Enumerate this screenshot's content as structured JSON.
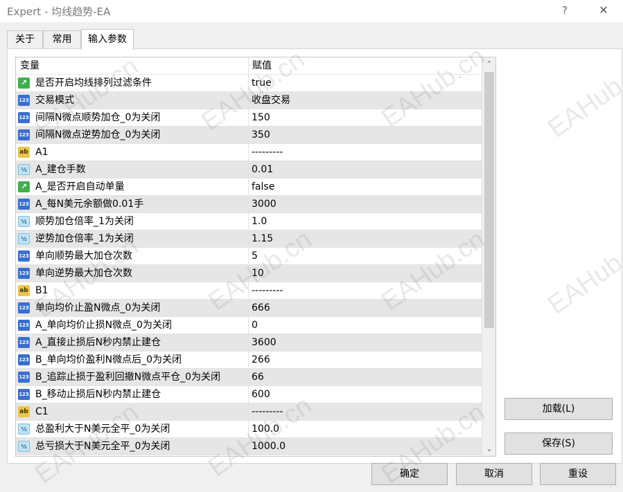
{
  "window": {
    "title": "Expert - 均线趋势-EA",
    "help_label": "?",
    "close_label": "✕"
  },
  "tabs": [
    {
      "label": "关于"
    },
    {
      "label": "常用"
    },
    {
      "label": "输入参数"
    }
  ],
  "grid": {
    "header": {
      "variable": "变量",
      "value": "赋值"
    },
    "rows": [
      {
        "type": "bool",
        "name": "是否开启均线排列过滤条件",
        "value": "true"
      },
      {
        "type": "int",
        "name": "交易模式",
        "value": "收盘交易"
      },
      {
        "type": "int",
        "name": "间隔N微点顺势加仓_0为关闭",
        "value": "150"
      },
      {
        "type": "int",
        "name": "间隔N微点逆势加仓_0为关闭",
        "value": "350"
      },
      {
        "type": "str",
        "name": "A1",
        "value": "---------"
      },
      {
        "type": "dbl",
        "name": "A_建仓手数",
        "value": "0.01"
      },
      {
        "type": "bool",
        "name": "A_是否开启自动单量",
        "value": "false"
      },
      {
        "type": "int",
        "name": "A_每N美元余额做0.01手",
        "value": "3000"
      },
      {
        "type": "dbl",
        "name": "顺势加仓倍率_1为关闭",
        "value": "1.0"
      },
      {
        "type": "dbl",
        "name": "逆势加仓倍率_1为关闭",
        "value": "1.15"
      },
      {
        "type": "int",
        "name": "单向顺势最大加仓次数",
        "value": "5"
      },
      {
        "type": "int",
        "name": "单向逆势最大加仓次数",
        "value": "10"
      },
      {
        "type": "str",
        "name": "B1",
        "value": "---------"
      },
      {
        "type": "int",
        "name": "单向均价止盈N微点_0为关闭",
        "value": "666"
      },
      {
        "type": "int",
        "name": "A_单向均价止损N微点_0为关闭",
        "value": "0"
      },
      {
        "type": "int",
        "name": "A_直接止损后N秒内禁止建仓",
        "value": "3600"
      },
      {
        "type": "int",
        "name": "B_单向均价盈利N微点后_0为关闭",
        "value": "266"
      },
      {
        "type": "int",
        "name": "B_追踪止损于盈利回撤N微点平仓_0为关闭",
        "value": "66"
      },
      {
        "type": "int",
        "name": "B_移动止损后N秒内禁止建仓",
        "value": "600"
      },
      {
        "type": "str",
        "name": "C1",
        "value": "---------"
      },
      {
        "type": "dbl",
        "name": "总盈利大于N美元全平_0为关闭",
        "value": "100.0"
      },
      {
        "type": "dbl",
        "name": "总亏损大于N美元全平_0为关闭",
        "value": "1000.0"
      }
    ],
    "scroll_up": "⌃",
    "scroll_down": "⌄"
  },
  "icons": {
    "bool": "bool-param-icon",
    "int": "integer-param-icon",
    "str": "string-param-icon",
    "dbl": "double-param-icon"
  },
  "buttons": {
    "load": "加载(L)",
    "save": "保存(S)",
    "ok": "确定",
    "cancel": "取消",
    "reset": "重设"
  },
  "watermark_text": "EAHub.cn"
}
